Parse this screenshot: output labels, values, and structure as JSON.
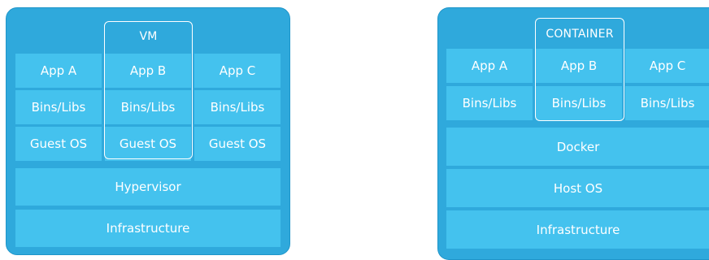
{
  "vm_stack": {
    "highlight_label": "VM",
    "apps": [
      "App A",
      "App B",
      "App C"
    ],
    "libs": [
      "Bins/Libs",
      "Bins/Libs",
      "Bins/Libs"
    ],
    "guest_os": [
      "Guest OS",
      "Guest OS",
      "Guest OS"
    ],
    "hypervisor": "Hypervisor",
    "infrastructure": "Infrastructure"
  },
  "container_stack": {
    "highlight_label": "CONTAINER",
    "apps": [
      "App A",
      "App B",
      "App C"
    ],
    "libs": [
      "Bins/Libs",
      "Bins/Libs",
      "Bins/Libs"
    ],
    "docker": "Docker",
    "host_os": "Host OS",
    "infrastructure": "Infrastructure"
  },
  "colors": {
    "panel": "#2fa9dc",
    "cell": "#44c2ee",
    "text": "#ffffff"
  }
}
